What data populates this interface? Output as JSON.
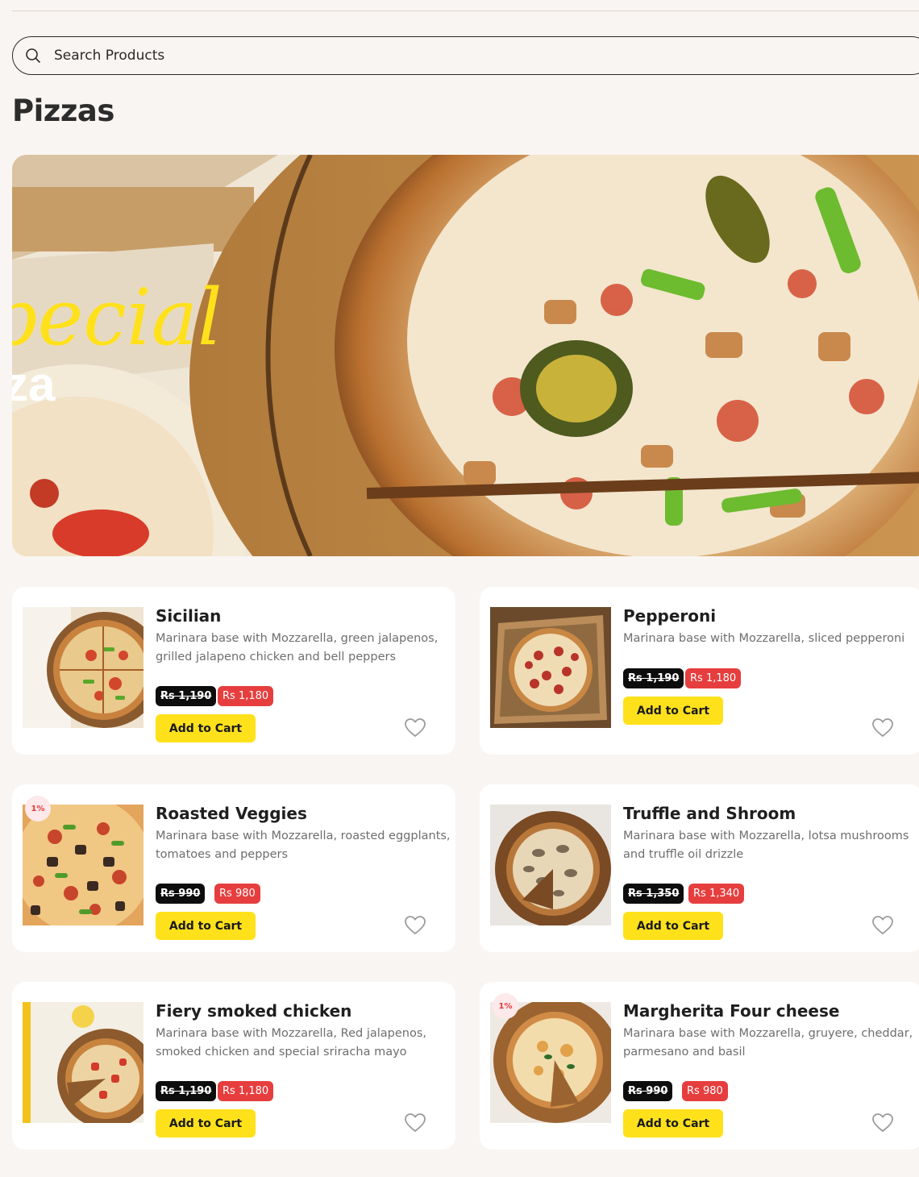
{
  "search": {
    "placeholder": "Search Products",
    "icon": "search-icon"
  },
  "page": {
    "title": "Pizzas"
  },
  "banner": {
    "script_text": "pecial",
    "bold_text": "za"
  },
  "colors": {
    "background": "#f9f5f2",
    "card": "#ffffff",
    "old_price_bg": "#0d0d0d",
    "new_price_bg": "#e63e3e",
    "cart_button": "#ffe11b",
    "discount_badge_bg": "#fde9e9",
    "discount_badge_text": "#e23b3b"
  },
  "products": [
    {
      "name": "Sicilian",
      "description": "Marinara base with Mozzarella, green jalapenos, grilled jalapeno chicken and bell peppers",
      "old_price": "Rs 1,190",
      "new_price": "Rs 1,180",
      "cart_label": "Add to Cart",
      "discount": "",
      "wishlist_icon": "heart-icon"
    },
    {
      "name": "Pepperoni",
      "description": "Marinara base with Mozzarella, sliced pepperoni",
      "old_price": "Rs 1,190",
      "new_price": "Rs 1,180",
      "cart_label": "Add to Cart",
      "discount": "",
      "wishlist_icon": "heart-icon"
    },
    {
      "name": "Roasted Veggies",
      "description": "Marinara base with Mozzarella, roasted eggplants, tomatoes and peppers",
      "old_price": "Rs 990",
      "new_price": "Rs 980",
      "cart_label": "Add to Cart",
      "discount": "1%",
      "wishlist_icon": "heart-icon"
    },
    {
      "name": "Truffle and Shroom",
      "description": "Marinara base with Mozzarella, lotsa mushrooms and truffle oil drizzle",
      "old_price": "Rs 1,350",
      "new_price": "Rs 1,340",
      "cart_label": "Add to Cart",
      "discount": "",
      "wishlist_icon": "heart-icon"
    },
    {
      "name": "Fiery smoked chicken",
      "description": "Marinara base with Mozzarella, Red jalapenos, smoked chicken and special sriracha mayo",
      "old_price": "Rs 1,190",
      "new_price": "Rs 1,180",
      "cart_label": "Add to Cart",
      "discount": "",
      "wishlist_icon": "heart-icon"
    },
    {
      "name": "Margherita Four cheese",
      "description": "Marinara base with Mozzarella, gruyere, cheddar, parmesano and basil",
      "old_price": "Rs 990",
      "new_price": "Rs 980",
      "cart_label": "Add to Cart",
      "discount": "1%",
      "wishlist_icon": "heart-icon"
    }
  ]
}
